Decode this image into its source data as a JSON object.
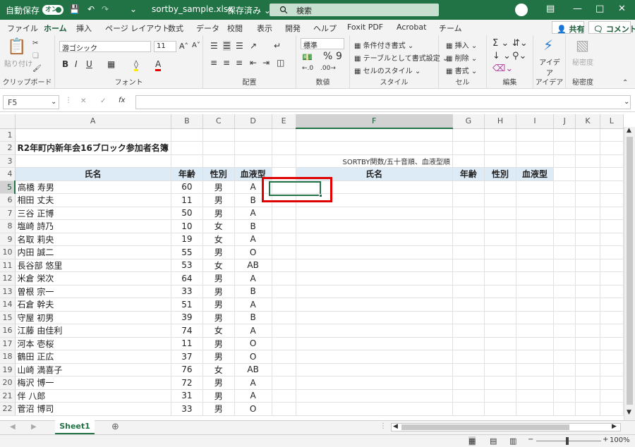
{
  "titlebar": {
    "autosave_label": "自動保存",
    "autosave_state": "オン",
    "filename": "sortby_sample.xlsx",
    "save_status": "保存済み",
    "search_placeholder": "検索"
  },
  "tabs": [
    "ファイル",
    "ホーム",
    "挿入",
    "ページ レイアウト",
    "数式",
    "データ",
    "校閲",
    "表示",
    "開発",
    "ヘルプ",
    "Foxit PDF",
    "Acrobat",
    "チーム"
  ],
  "active_tab": "ホーム",
  "share_label": "共有",
  "comment_label": "コメント",
  "ribbon": {
    "clipboard": {
      "paste": "貼り付け",
      "label": "クリップボード"
    },
    "font": {
      "name": "游ゴシック",
      "size": "11",
      "label": "フォント",
      "bold": "B",
      "italic": "I",
      "underline": "U"
    },
    "alignment": {
      "label": "配置"
    },
    "number": {
      "format": "標準",
      "label": "数値"
    },
    "styles": {
      "cond": "条件付き書式",
      "table": "テーブルとして書式設定",
      "cell": "セルのスタイル",
      "label": "スタイル"
    },
    "cells": {
      "insert": "挿入",
      "delete": "削除",
      "format": "書式",
      "label": "セル"
    },
    "editing": {
      "label": "編集"
    },
    "ideas": {
      "btn": "アイデア",
      "label": "アイデア"
    },
    "sensitivity": {
      "btn": "秘密度",
      "label": "秘密度"
    }
  },
  "formula_bar": {
    "name_box": "F5",
    "fx": "fx",
    "formula": ""
  },
  "columns": [
    "A",
    "B",
    "C",
    "D",
    "E",
    "F",
    "G",
    "H",
    "I",
    "J",
    "K",
    "L"
  ],
  "selected_column": "F",
  "selected_row": "5",
  "sheet": {
    "title": "R2年町内新年会16ブロック参加者名簿",
    "note": "SORTBY関数/五十音順、血液型順",
    "headers": [
      "氏名",
      "年齢",
      "性別",
      "血液型"
    ],
    "out_headers": [
      "氏名",
      "年齢",
      "性別",
      "血液型"
    ],
    "rows": [
      {
        "n": "5",
        "name": "高橋 寿男",
        "age": "60",
        "sex": "男",
        "blood": "A"
      },
      {
        "n": "6",
        "name": "相田 丈夫",
        "age": "11",
        "sex": "男",
        "blood": "B"
      },
      {
        "n": "7",
        "name": "三谷 正博",
        "age": "50",
        "sex": "男",
        "blood": "A"
      },
      {
        "n": "8",
        "name": "塩崎 詩乃",
        "age": "10",
        "sex": "女",
        "blood": "B"
      },
      {
        "n": "9",
        "name": "名取 莉央",
        "age": "19",
        "sex": "女",
        "blood": "A"
      },
      {
        "n": "10",
        "name": "内田 誠二",
        "age": "55",
        "sex": "男",
        "blood": "O"
      },
      {
        "n": "11",
        "name": "長谷部 悠里",
        "age": "53",
        "sex": "女",
        "blood": "AB"
      },
      {
        "n": "12",
        "name": "米倉 栄次",
        "age": "64",
        "sex": "男",
        "blood": "A"
      },
      {
        "n": "13",
        "name": "曽根 宗一",
        "age": "33",
        "sex": "男",
        "blood": "B"
      },
      {
        "n": "14",
        "name": "石倉 幹夫",
        "age": "51",
        "sex": "男",
        "blood": "A"
      },
      {
        "n": "15",
        "name": "守屋 初男",
        "age": "39",
        "sex": "男",
        "blood": "B"
      },
      {
        "n": "16",
        "name": "江藤 由佳利",
        "age": "74",
        "sex": "女",
        "blood": "A"
      },
      {
        "n": "17",
        "name": "河本 壱桜",
        "age": "11",
        "sex": "男",
        "blood": "O"
      },
      {
        "n": "18",
        "name": "鶴田 正広",
        "age": "37",
        "sex": "男",
        "blood": "O"
      },
      {
        "n": "19",
        "name": "山崎 満喜子",
        "age": "76",
        "sex": "女",
        "blood": "AB"
      },
      {
        "n": "20",
        "name": "梅沢 博一",
        "age": "72",
        "sex": "男",
        "blood": "A"
      },
      {
        "n": "21",
        "name": "伴 八郎",
        "age": "31",
        "sex": "男",
        "blood": "A"
      },
      {
        "n": "22",
        "name": "菅沼 博司",
        "age": "33",
        "sex": "男",
        "blood": "O"
      }
    ]
  },
  "sheet_tab": "Sheet1",
  "zoom": "100%",
  "colors": {
    "accent": "#217346",
    "header_fill": "#ddebf7",
    "highlight": "#e00000"
  }
}
